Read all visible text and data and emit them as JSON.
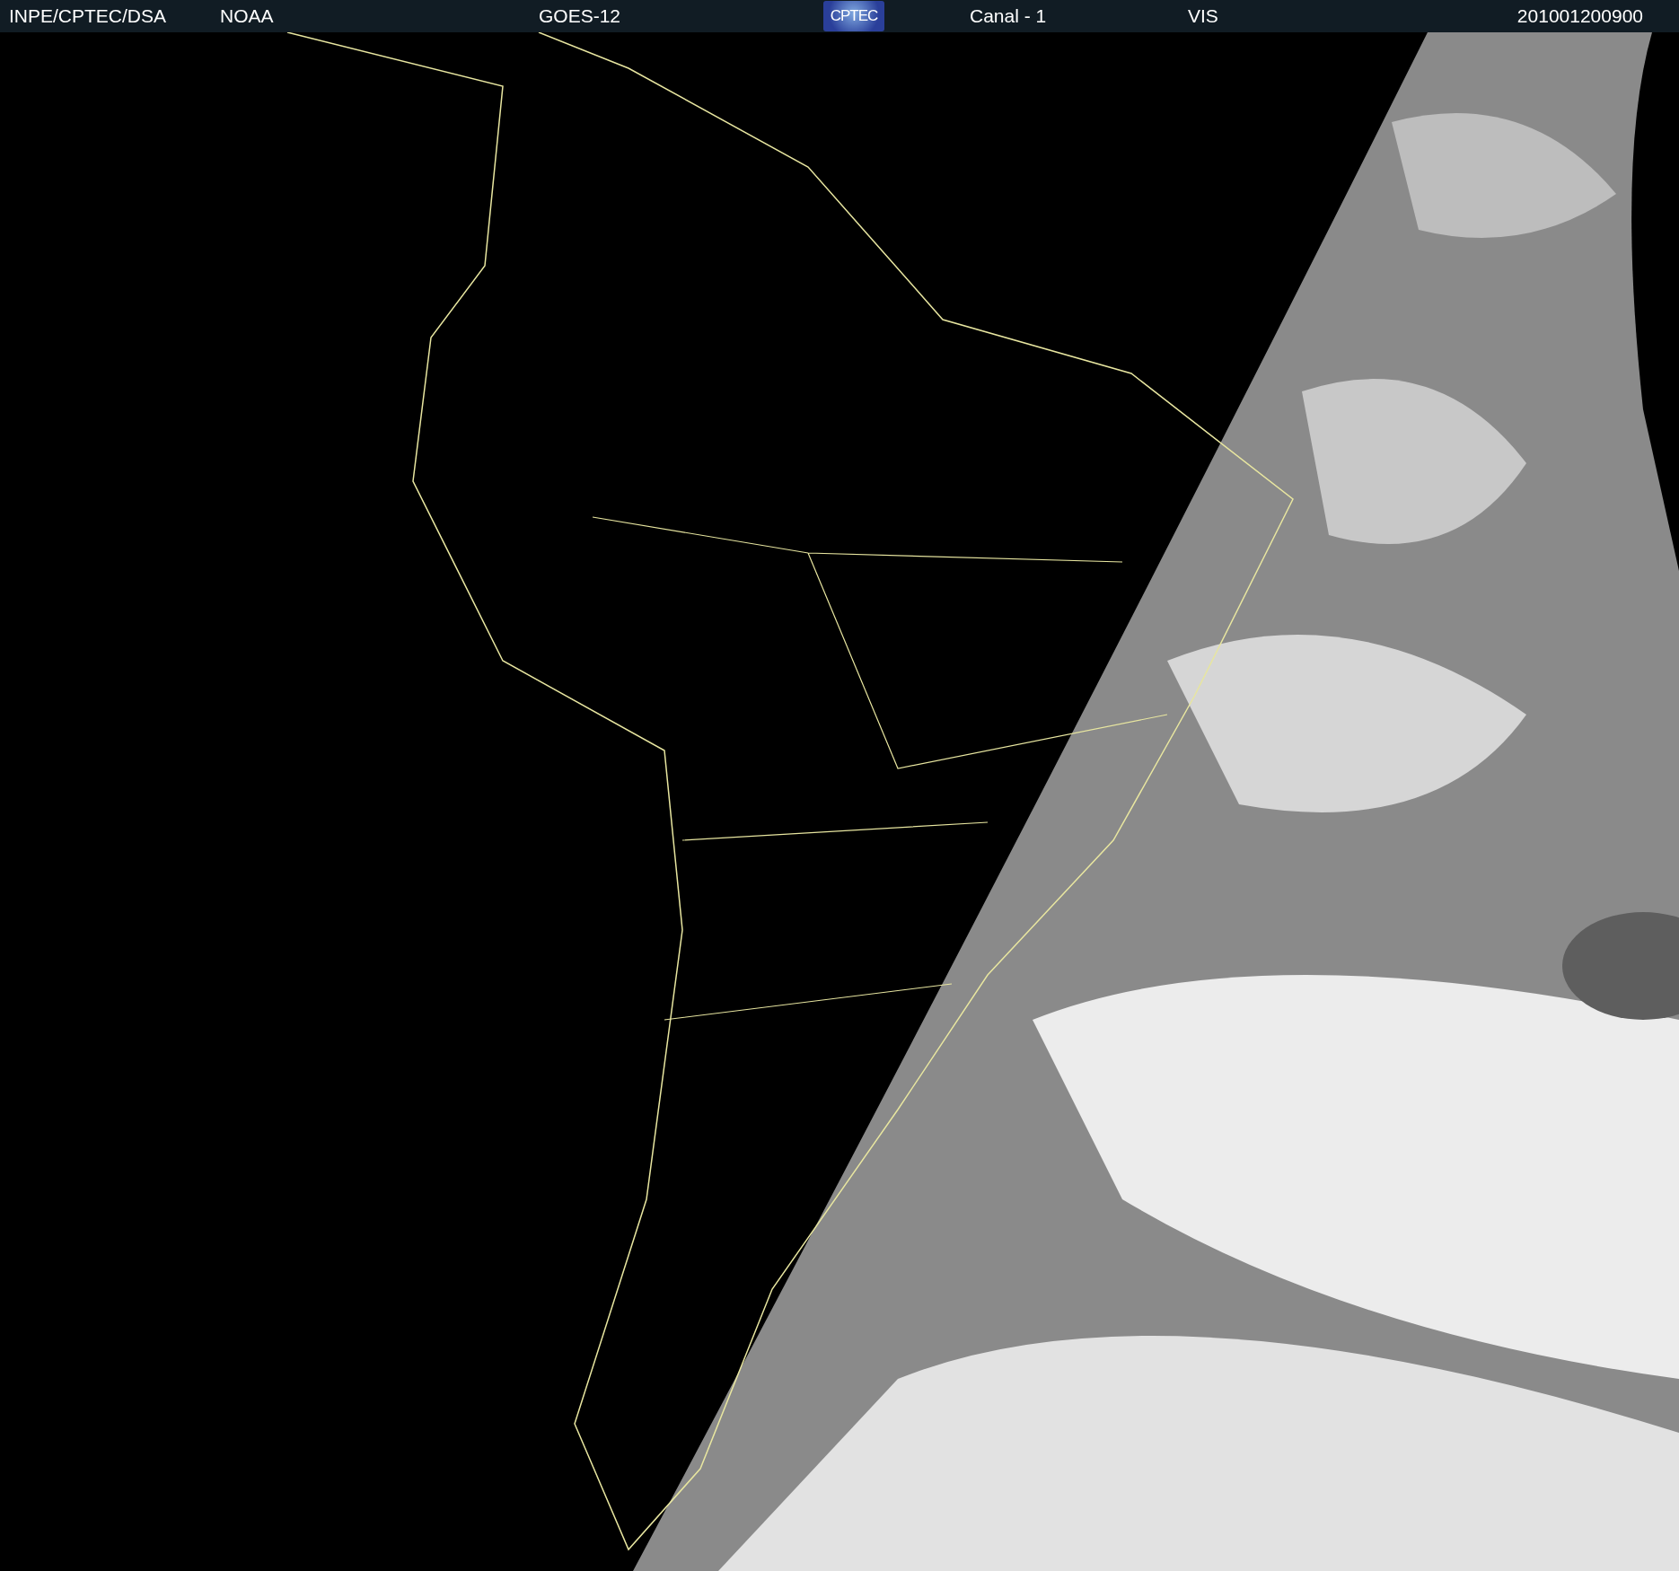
{
  "header": {
    "items": [
      {
        "kind": "text",
        "text": "INPE/CPTEC/DSA"
      },
      {
        "kind": "text",
        "text": "NOAA"
      },
      {
        "kind": "text",
        "text": "GOES-12"
      },
      {
        "kind": "logo",
        "text": "CPTEC"
      },
      {
        "kind": "text",
        "text": "Canal - 1"
      },
      {
        "kind": "text",
        "text": "VIS"
      },
      {
        "kind": "text",
        "text": "201001200900"
      }
    ]
  }
}
